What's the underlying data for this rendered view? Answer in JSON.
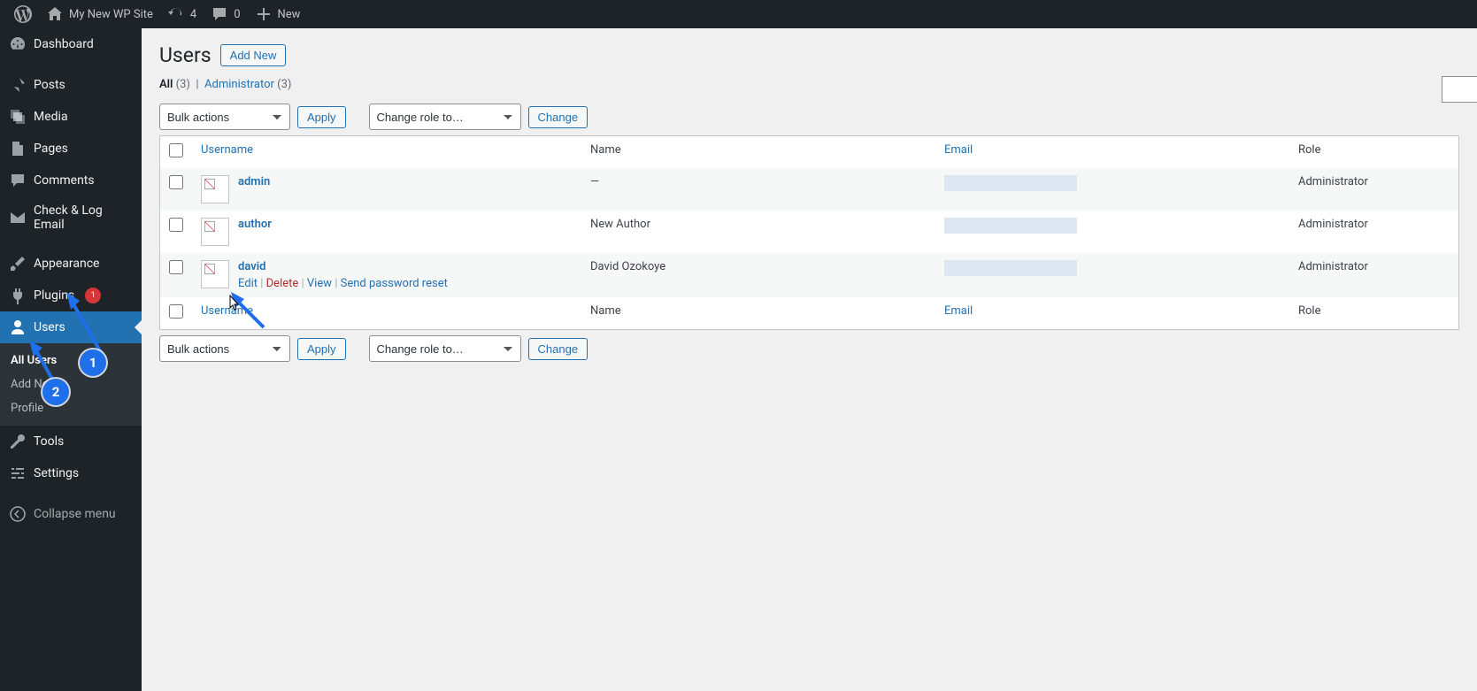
{
  "adminbar": {
    "site_name": "My New WP Site",
    "updates": "4",
    "comments": "0",
    "new_label": "New"
  },
  "sidebar": {
    "items": [
      {
        "label": "Dashboard"
      },
      {
        "label": "Posts"
      },
      {
        "label": "Media"
      },
      {
        "label": "Pages"
      },
      {
        "label": "Comments"
      },
      {
        "label": "Check & Log Email"
      },
      {
        "label": "Appearance"
      },
      {
        "label": "Plugins",
        "badge": "1"
      },
      {
        "label": "Users"
      },
      {
        "label": "Tools"
      },
      {
        "label": "Settings"
      }
    ],
    "submenu": {
      "items": [
        {
          "label": "All Users"
        },
        {
          "label": "Add New"
        },
        {
          "label": "Profile"
        }
      ]
    },
    "collapse": "Collapse menu"
  },
  "page": {
    "title": "Users",
    "add_new": "Add New",
    "filters": {
      "all_label": "All",
      "all_count": "(3)",
      "admin_label": "Administrator",
      "admin_count": "(3)"
    },
    "bulk_label": "Bulk actions",
    "apply": "Apply",
    "role_label": "Change role to…",
    "change": "Change",
    "columns": {
      "username": "Username",
      "name": "Name",
      "email": "Email",
      "role": "Role"
    },
    "users": [
      {
        "username": "admin",
        "name": "—",
        "role": "Administrator"
      },
      {
        "username": "author",
        "name": "New Author",
        "role": "Administrator"
      },
      {
        "username": "david",
        "name": "David Ozokoye",
        "role": "Administrator"
      }
    ],
    "row_actions": {
      "edit": "Edit",
      "delete": "Delete",
      "view": "View",
      "reset": "Send password reset"
    }
  },
  "annotations": {
    "badge1": "1",
    "badge2": "2"
  }
}
